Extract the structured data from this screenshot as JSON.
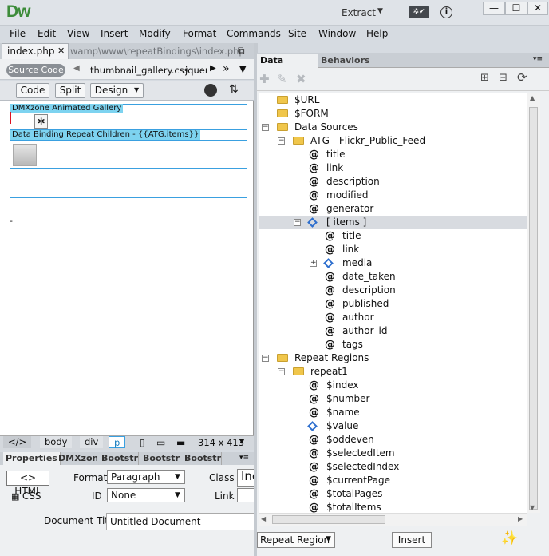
{
  "app": {
    "logo": "Dw",
    "workspace": "Extract",
    "sync_icon": "gear-check",
    "info_icon": "i"
  },
  "window_controls": {
    "minimize": "—",
    "maximize": "☐",
    "close": "✕"
  },
  "menus": [
    "File",
    "Edit",
    "View",
    "Insert",
    "Modify",
    "Format",
    "Commands",
    "Site",
    "Window",
    "Help"
  ],
  "document": {
    "tab": "index.php",
    "path": "wamp\\www\\repeatBindings\\index.php",
    "related": {
      "source": "Source Code",
      "css": "thumbnail_gallery.css",
      "next": "jquer"
    },
    "views": {
      "code": "Code",
      "split": "Split",
      "design": "Design"
    },
    "design": {
      "gallery_label": "DMXzone Animated Gallery",
      "repeat_label": "Data Binding Repeat Children - {{ATG.items}}",
      "dash": "-"
    },
    "tagbar": {
      "code_tag": "</>",
      "body": "body",
      "div": "div",
      "p": "p",
      "dims": "314 x 413"
    }
  },
  "properties": {
    "tabs": [
      "Properties",
      "DMXzone",
      "Bootstrap",
      "Bootstrap",
      "Bootstrap"
    ],
    "html_button": "HTML",
    "css_button": "CSS",
    "format_label": "Format",
    "format_value": "Paragraph",
    "class_label": "Class",
    "class_value": "Inc",
    "id_label": "ID",
    "id_value": "None",
    "link_label": "Link",
    "doc_title_label": "Document Title",
    "doc_title_value": "Untitled Document"
  },
  "panel": {
    "tabs": [
      "Data Bindings",
      "Behaviors"
    ],
    "tree": [
      {
        "indent": 0,
        "kind": "folder",
        "label": "$URL"
      },
      {
        "indent": 0,
        "kind": "folder",
        "label": "$FORM"
      },
      {
        "indent": 0,
        "kind": "folder",
        "expander": "−",
        "label": "Data Sources"
      },
      {
        "indent": 1,
        "kind": "folder",
        "expander": "−",
        "label": "ATG - Flickr_Public_Feed"
      },
      {
        "indent": 2,
        "kind": "at",
        "label": "title"
      },
      {
        "indent": 2,
        "kind": "at",
        "label": "link"
      },
      {
        "indent": 2,
        "kind": "at",
        "label": "description"
      },
      {
        "indent": 2,
        "kind": "at",
        "label": "modified"
      },
      {
        "indent": 2,
        "kind": "at",
        "label": "generator"
      },
      {
        "indent": 2,
        "kind": "array",
        "expander": "−",
        "label": "[ items ]",
        "selected": true
      },
      {
        "indent": 3,
        "kind": "at",
        "label": "title"
      },
      {
        "indent": 3,
        "kind": "at",
        "label": "link"
      },
      {
        "indent": 3,
        "kind": "object",
        "expander": "+",
        "label": "media"
      },
      {
        "indent": 3,
        "kind": "at",
        "label": "date_taken"
      },
      {
        "indent": 3,
        "kind": "at",
        "label": "description"
      },
      {
        "indent": 3,
        "kind": "at",
        "label": "published"
      },
      {
        "indent": 3,
        "kind": "at",
        "label": "author"
      },
      {
        "indent": 3,
        "kind": "at",
        "label": "author_id"
      },
      {
        "indent": 3,
        "kind": "at",
        "label": "tags"
      },
      {
        "indent": 0,
        "kind": "folder",
        "expander": "−",
        "label": "Repeat Regions"
      },
      {
        "indent": 1,
        "kind": "folder",
        "expander": "−",
        "label": "repeat1"
      },
      {
        "indent": 2,
        "kind": "at",
        "label": "$index"
      },
      {
        "indent": 2,
        "kind": "at",
        "label": "$number"
      },
      {
        "indent": 2,
        "kind": "at",
        "label": "$name"
      },
      {
        "indent": 2,
        "kind": "object",
        "label": "$value"
      },
      {
        "indent": 2,
        "kind": "at",
        "label": "$oddeven"
      },
      {
        "indent": 2,
        "kind": "at",
        "label": "$selectedItem"
      },
      {
        "indent": 2,
        "kind": "at",
        "label": "$selectedIndex"
      },
      {
        "indent": 2,
        "kind": "at",
        "label": "$currentPage"
      },
      {
        "indent": 2,
        "kind": "at",
        "label": "$totalPages"
      },
      {
        "indent": 2,
        "kind": "at",
        "label": "$totalItems"
      }
    ],
    "bottom_select": "Repeat Region",
    "insert_button": "Insert"
  }
}
